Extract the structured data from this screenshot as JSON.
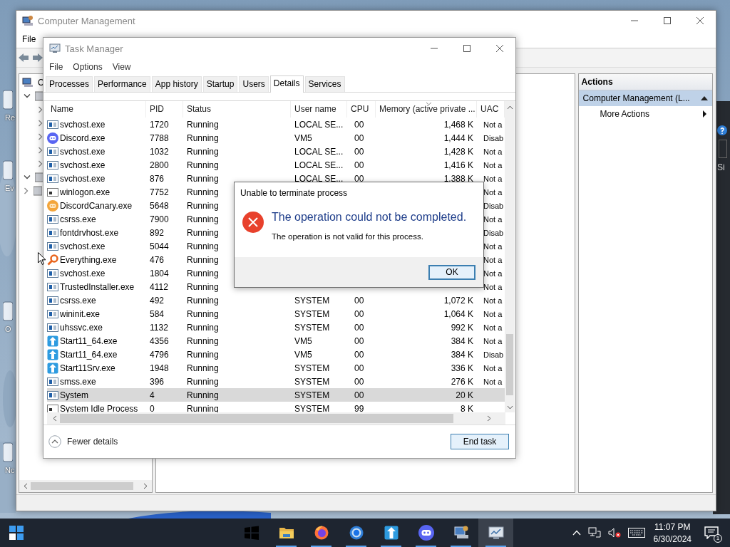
{
  "desktop": {
    "icons": [
      {
        "label": "Re"
      },
      {
        "label": "Ev"
      },
      {
        "label": "O"
      },
      {
        "label": "Nc"
      }
    ]
  },
  "back_window": {
    "label": "Si"
  },
  "computer_management": {
    "title": "Computer Management",
    "menu": [
      "File"
    ],
    "tree": [
      {
        "label": "C",
        "expanded": true,
        "children": [
          {
            "expanded": true,
            "children": [
              {
                "expanded": false
              },
              {
                "expanded": false
              },
              {
                "expanded": false
              },
              {
                "expanded": false
              },
              {
                "expanded": false
              }
            ]
          },
          {
            "expanded": true
          },
          {
            "expanded": false
          }
        ]
      }
    ],
    "actions": {
      "title": "Actions",
      "groups": [
        {
          "label": "Computer Management (L...",
          "selected": true,
          "expanded": true,
          "items": [
            {
              "label": "More Actions",
              "submenu": true
            }
          ]
        }
      ]
    }
  },
  "task_manager": {
    "title": "Task Manager",
    "menu": [
      "File",
      "Options",
      "View"
    ],
    "tabs": [
      {
        "label": "Processes",
        "selected": false
      },
      {
        "label": "Performance",
        "selected": false
      },
      {
        "label": "App history",
        "selected": false
      },
      {
        "label": "Startup",
        "selected": false
      },
      {
        "label": "Users",
        "selected": false
      },
      {
        "label": "Details",
        "selected": true
      },
      {
        "label": "Services",
        "selected": false
      }
    ],
    "columns": [
      "Name",
      "PID",
      "Status",
      "User name",
      "CPU",
      "Memory (active private ...",
      "UAC"
    ],
    "rows": [
      {
        "kind": "service",
        "name": "svchost.exe",
        "pid": "1720",
        "status": "Running",
        "user": "LOCAL SE...",
        "cpu": "00",
        "memory": "1,468 K",
        "uac": "Not a",
        "selected": false
      },
      {
        "kind": "discord",
        "name": "Discord.exe",
        "pid": "7788",
        "status": "Running",
        "user": "VM5",
        "cpu": "00",
        "memory": "1,444 K",
        "uac": "Disab",
        "selected": false
      },
      {
        "kind": "service",
        "name": "svchost.exe",
        "pid": "1032",
        "status": "Running",
        "user": "LOCAL SE...",
        "cpu": "00",
        "memory": "1,428 K",
        "uac": "Not a",
        "selected": false
      },
      {
        "kind": "service",
        "name": "svchost.exe",
        "pid": "2800",
        "status": "Running",
        "user": "LOCAL SE...",
        "cpu": "00",
        "memory": "1,416 K",
        "uac": "Not a",
        "selected": false
      },
      {
        "kind": "service",
        "name": "svchost.exe",
        "pid": "876",
        "status": "Running",
        "user": "LOCAL SE...",
        "cpu": "00",
        "memory": "1,388 K",
        "uac": "Not a",
        "selected": false
      },
      {
        "kind": "plain",
        "name": "winlogon.exe",
        "pid": "7752",
        "status": "Running",
        "uac": "Not a",
        "selected": false
      },
      {
        "kind": "canary",
        "name": "DiscordCanary.exe",
        "pid": "5648",
        "status": "Running",
        "uac": "Disab",
        "selected": false
      },
      {
        "kind": "service",
        "name": "csrss.exe",
        "pid": "7900",
        "status": "Running",
        "uac": "Not a",
        "selected": false
      },
      {
        "kind": "service",
        "name": "fontdrvhost.exe",
        "pid": "892",
        "status": "Running",
        "uac": "Disab",
        "selected": false
      },
      {
        "kind": "service",
        "name": "svchost.exe",
        "pid": "5044",
        "status": "Running",
        "uac": "Not a",
        "selected": false
      },
      {
        "kind": "everything",
        "name": "Everything.exe",
        "pid": "476",
        "status": "Running",
        "uac": "Not a",
        "selected": false
      },
      {
        "kind": "service",
        "name": "svchost.exe",
        "pid": "1804",
        "status": "Running",
        "uac": "Not a",
        "selected": false
      },
      {
        "kind": "service",
        "name": "TrustedInstaller.exe",
        "pid": "4112",
        "status": "Running",
        "uac": "Not a",
        "selected": false
      },
      {
        "kind": "service",
        "name": "csrss.exe",
        "pid": "492",
        "status": "Running",
        "user": "SYSTEM",
        "cpu": "00",
        "memory": "1,072 K",
        "uac": "Not a",
        "selected": false
      },
      {
        "kind": "service",
        "name": "wininit.exe",
        "pid": "584",
        "status": "Running",
        "user": "SYSTEM",
        "cpu": "00",
        "memory": "1,064 K",
        "uac": "Not a",
        "selected": false
      },
      {
        "kind": "service",
        "name": "uhssvc.exe",
        "pid": "1132",
        "status": "Running",
        "user": "SYSTEM",
        "cpu": "00",
        "memory": "992 K",
        "uac": "Not a",
        "selected": false
      },
      {
        "kind": "start11",
        "name": "Start11_64.exe",
        "pid": "4356",
        "status": "Running",
        "user": "VM5",
        "cpu": "00",
        "memory": "384 K",
        "uac": "Not a",
        "selected": false
      },
      {
        "kind": "start11",
        "name": "Start11_64.exe",
        "pid": "4796",
        "status": "Running",
        "user": "VM5",
        "cpu": "00",
        "memory": "384 K",
        "uac": "Disab",
        "selected": false
      },
      {
        "kind": "start11",
        "name": "Start11Srv.exe",
        "pid": "1948",
        "status": "Running",
        "user": "SYSTEM",
        "cpu": "00",
        "memory": "336 K",
        "uac": "Not a",
        "selected": false
      },
      {
        "kind": "service",
        "name": "smss.exe",
        "pid": "396",
        "status": "Running",
        "user": "SYSTEM",
        "cpu": "00",
        "memory": "276 K",
        "uac": "Not a",
        "selected": false
      },
      {
        "kind": "service",
        "name": "System",
        "pid": "4",
        "status": "Running",
        "user": "SYSTEM",
        "cpu": "00",
        "memory": "20 K",
        "selected": true
      },
      {
        "kind": "plain",
        "name": "System Idle Process",
        "pid": "0",
        "status": "Running",
        "user": "SYSTEM",
        "cpu": "99",
        "memory": "8 K",
        "selected": false
      }
    ],
    "fewer_details": "Fewer details",
    "end_task": "End task"
  },
  "dialog": {
    "title": "Unable to terminate process",
    "heading": "The operation could not be completed.",
    "message": "The operation is not valid for this process.",
    "buttons": [
      {
        "label": "OK",
        "default": true
      }
    ]
  },
  "taskbar": {
    "apps": [
      {
        "kind": "windows",
        "running": false,
        "selected": false
      },
      {
        "kind": "folder",
        "running": true,
        "selected": false
      },
      {
        "kind": "firefox",
        "running": true,
        "selected": false
      },
      {
        "kind": "chrome",
        "running": true,
        "selected": false
      },
      {
        "kind": "start11",
        "running": true,
        "selected": false
      },
      {
        "kind": "discord",
        "running": true,
        "selected": false
      },
      {
        "kind": "compmgmt",
        "running": true,
        "selected": false
      },
      {
        "kind": "taskmgr",
        "running": true,
        "selected": true
      }
    ],
    "time": "11:07 PM",
    "date": "6/30/2024",
    "notifications": "1"
  }
}
